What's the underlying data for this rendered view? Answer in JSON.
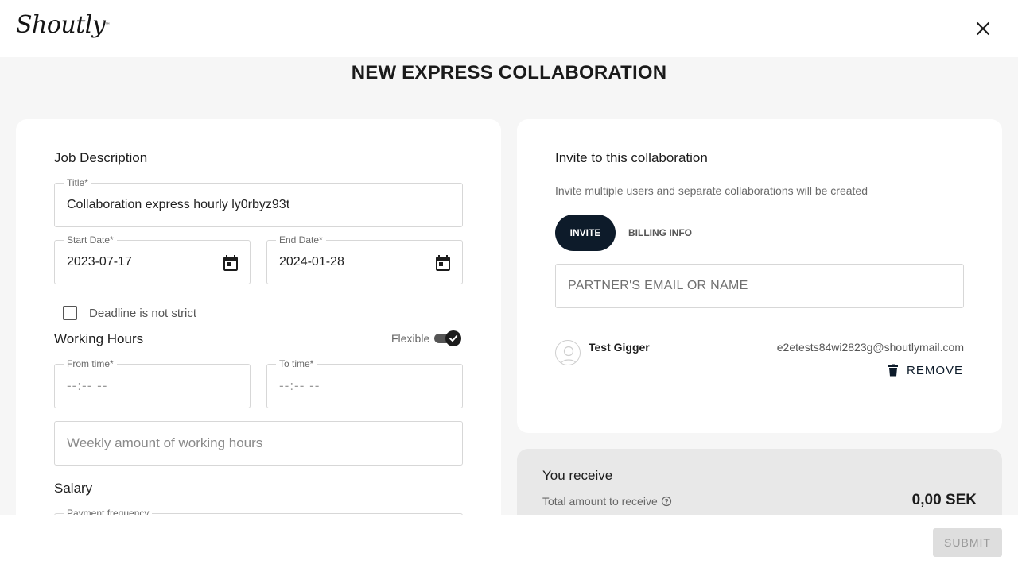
{
  "header": {
    "logo_text": "Shoutly",
    "logo_mark": "™",
    "close_icon": "close-icon"
  },
  "page": {
    "title": "NEW EXPRESS COLLABORATION"
  },
  "job": {
    "section_title": "Job Description",
    "title_label": "Title*",
    "title_value": "Collaboration express hourly ly0rbyz93t",
    "start_label": "Start Date*",
    "start_value": "2023-07-17",
    "end_label": "End Date*",
    "end_value": "2024-01-28",
    "calendar_icon": "calendar-icon",
    "deadline_label": "Deadline is not strict",
    "deadline_checked": false
  },
  "hours": {
    "section_title": "Working Hours",
    "flexible_label": "Flexible",
    "flexible_on": true,
    "from_label": "From time*",
    "from_placeholder": "--:-- --",
    "to_label": "To time*",
    "to_placeholder": "--:-- --",
    "weekly_placeholder": "Weekly amount of working hours"
  },
  "salary": {
    "section_title": "Salary",
    "frequency_label": "Payment frequency"
  },
  "invite": {
    "section_title": "Invite to this collaboration",
    "subtitle": "Invite multiple users and separate collaborations will be created",
    "tabs": [
      {
        "label": "INVITE",
        "active": true
      },
      {
        "label": "BILLING INFO",
        "active": false
      }
    ],
    "email_placeholder": "PARTNER'S EMAIL OR NAME",
    "users": [
      {
        "name": "Test Gigger",
        "email": "e2etests84wi2823g@shoutlymail.com",
        "remove_label": "REMOVE"
      }
    ]
  },
  "receive": {
    "title": "You receive",
    "total_label": "Total amount to receive",
    "total_value": "0,00 SEK"
  },
  "footer": {
    "submit_label": "SUBMIT"
  },
  "colors": {
    "accent_dark": "#0d1b2a",
    "background": "#f6f6f6"
  }
}
